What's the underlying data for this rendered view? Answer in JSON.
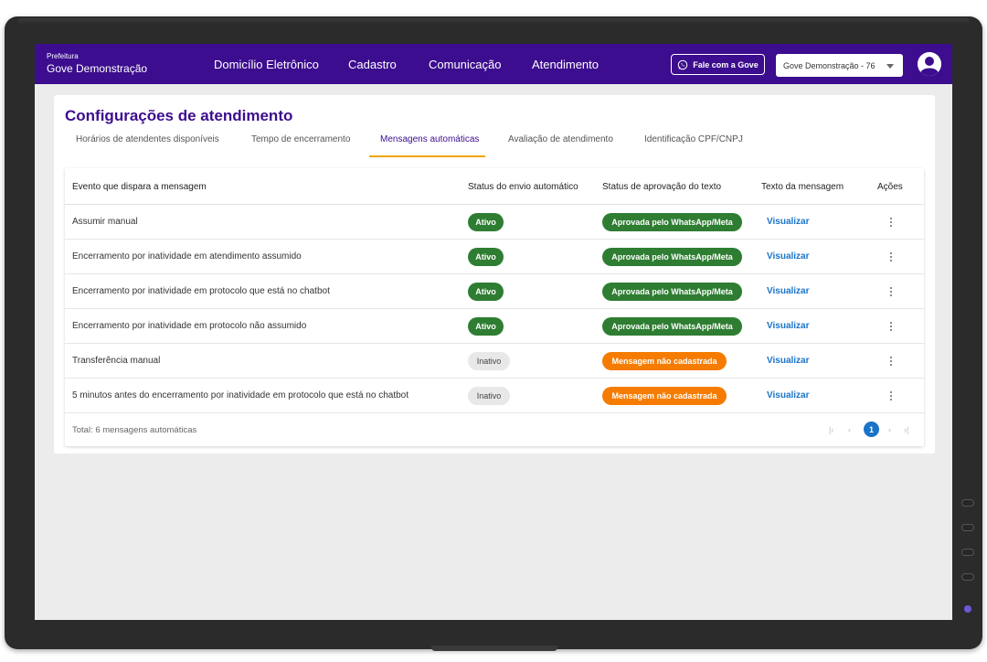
{
  "header": {
    "brand_small": "Prefeitura",
    "brand_main": "Gove Demonstração",
    "nav": [
      "Domicílio Eletrônico",
      "Cadastro",
      "Comunicação",
      "Atendimento"
    ],
    "fale_label": "Fale com a Gove",
    "org_select": "Gove Demonstração - 76"
  },
  "page": {
    "title": "Configurações de atendimento",
    "tabs": [
      "Horários de atendentes disponíveis",
      "Tempo de encerramento",
      "Mensagens automáticas",
      "Avaliação de atendimento",
      "Identificação CPF/CNPJ"
    ],
    "active_tab": "Mensagens automáticas"
  },
  "table": {
    "columns": [
      "Evento que dispara a mensagem",
      "Status do envio automático",
      "Status de aprovação do texto",
      "Texto da mensagem",
      "Ações"
    ],
    "rows": [
      {
        "event": "Assumir manual",
        "send_status": "Ativo",
        "approval": "Aprovada pelo WhatsApp/Meta",
        "text": "Visualizar"
      },
      {
        "event": "Encerramento por inatividade em atendimento assumido",
        "send_status": "Ativo",
        "approval": "Aprovada pelo WhatsApp/Meta",
        "text": "Visualizar"
      },
      {
        "event": "Encerramento por inatividade em protocolo que está no chatbot",
        "send_status": "Ativo",
        "approval": "Aprovada pelo WhatsApp/Meta",
        "text": "Visualizar"
      },
      {
        "event": "Encerramento por inatividade em protocolo não assumido",
        "send_status": "Ativo",
        "approval": "Aprovada pelo WhatsApp/Meta",
        "text": "Visualizar"
      },
      {
        "event": "Transferência manual",
        "send_status": "Inativo",
        "approval": "Mensagem não cadastrada",
        "text": "Visualizar"
      },
      {
        "event": "5 minutos antes do encerramento por inatividade em protocolo que está no chatbot",
        "send_status": "Inativo",
        "approval": "Mensagem não cadastrada",
        "text": "Visualizar"
      }
    ],
    "footer_total": "Total: 6 mensagens automáticas",
    "pagination": {
      "current": "1"
    }
  },
  "colors": {
    "brand": "#3c0d8e",
    "active_green": "#2e7d32",
    "missing_orange": "#f57c00",
    "link_blue": "#1a73c8",
    "tab_accent": "#f0a500"
  },
  "icons": [
    "whatsapp-icon",
    "chevron-down-icon",
    "user-avatar-icon",
    "kebab-menu-icon",
    "first-page-icon",
    "prev-page-icon",
    "next-page-icon",
    "last-page-icon"
  ]
}
